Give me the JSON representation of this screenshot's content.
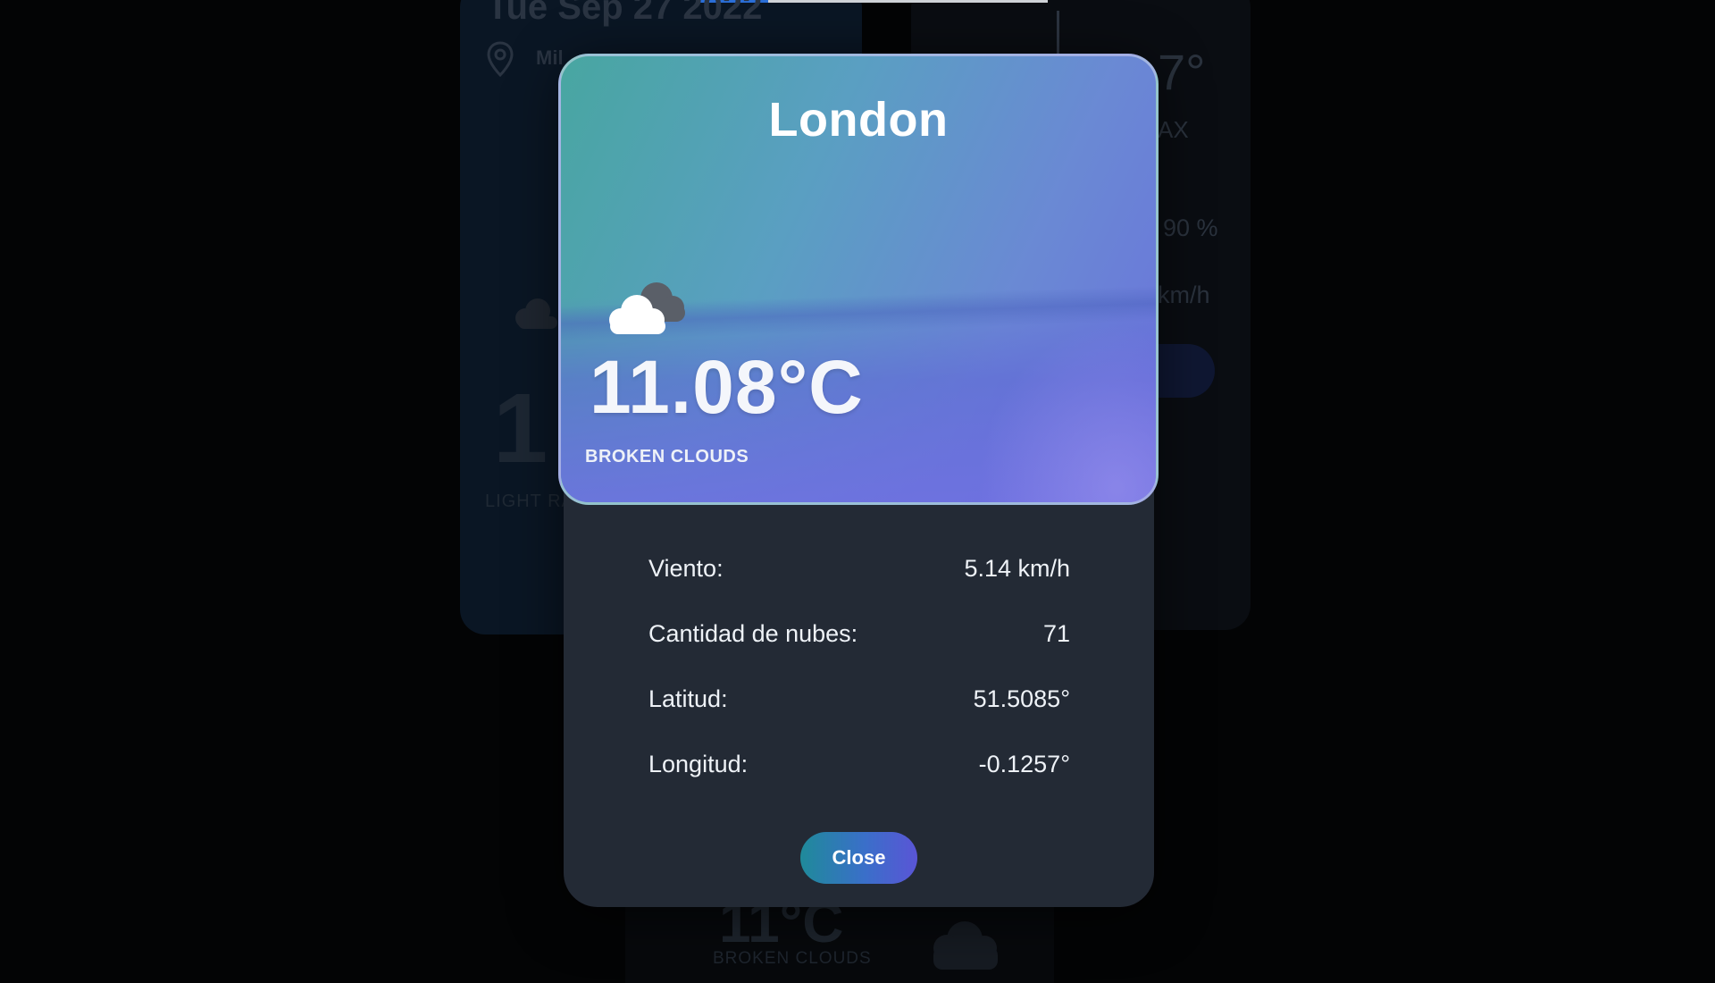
{
  "background": {
    "date": "Tue Sep 27 2022",
    "location": "Mil",
    "main_temp": "1",
    "description": "LIGHT RA",
    "side_temp": "7°",
    "side_max": "AX",
    "humidity": "90 %",
    "wind": "km/h",
    "bottom_temp": "11°C",
    "bottom_description": "BROKEN CLOUDS"
  },
  "modal": {
    "city": "London",
    "temperature": "11.08°C",
    "description": "BROKEN CLOUDS",
    "weather_icon": "cloud-icon",
    "stats": [
      {
        "label": "Viento:",
        "value": "5.14 km/h"
      },
      {
        "label": "Cantidad de nubes:",
        "value": "71"
      },
      {
        "label": "Latitud:",
        "value": "51.5085°"
      },
      {
        "label": "Longitud:",
        "value": "-0.1257°"
      }
    ],
    "close_label": "Close"
  },
  "colors": {
    "overlay": "#030405",
    "modal_bg": "#232a35",
    "hero_start": "#48a6a1",
    "hero_end": "#6b72dc",
    "button_start": "#1f8a9a",
    "button_end": "#5a55d6"
  }
}
